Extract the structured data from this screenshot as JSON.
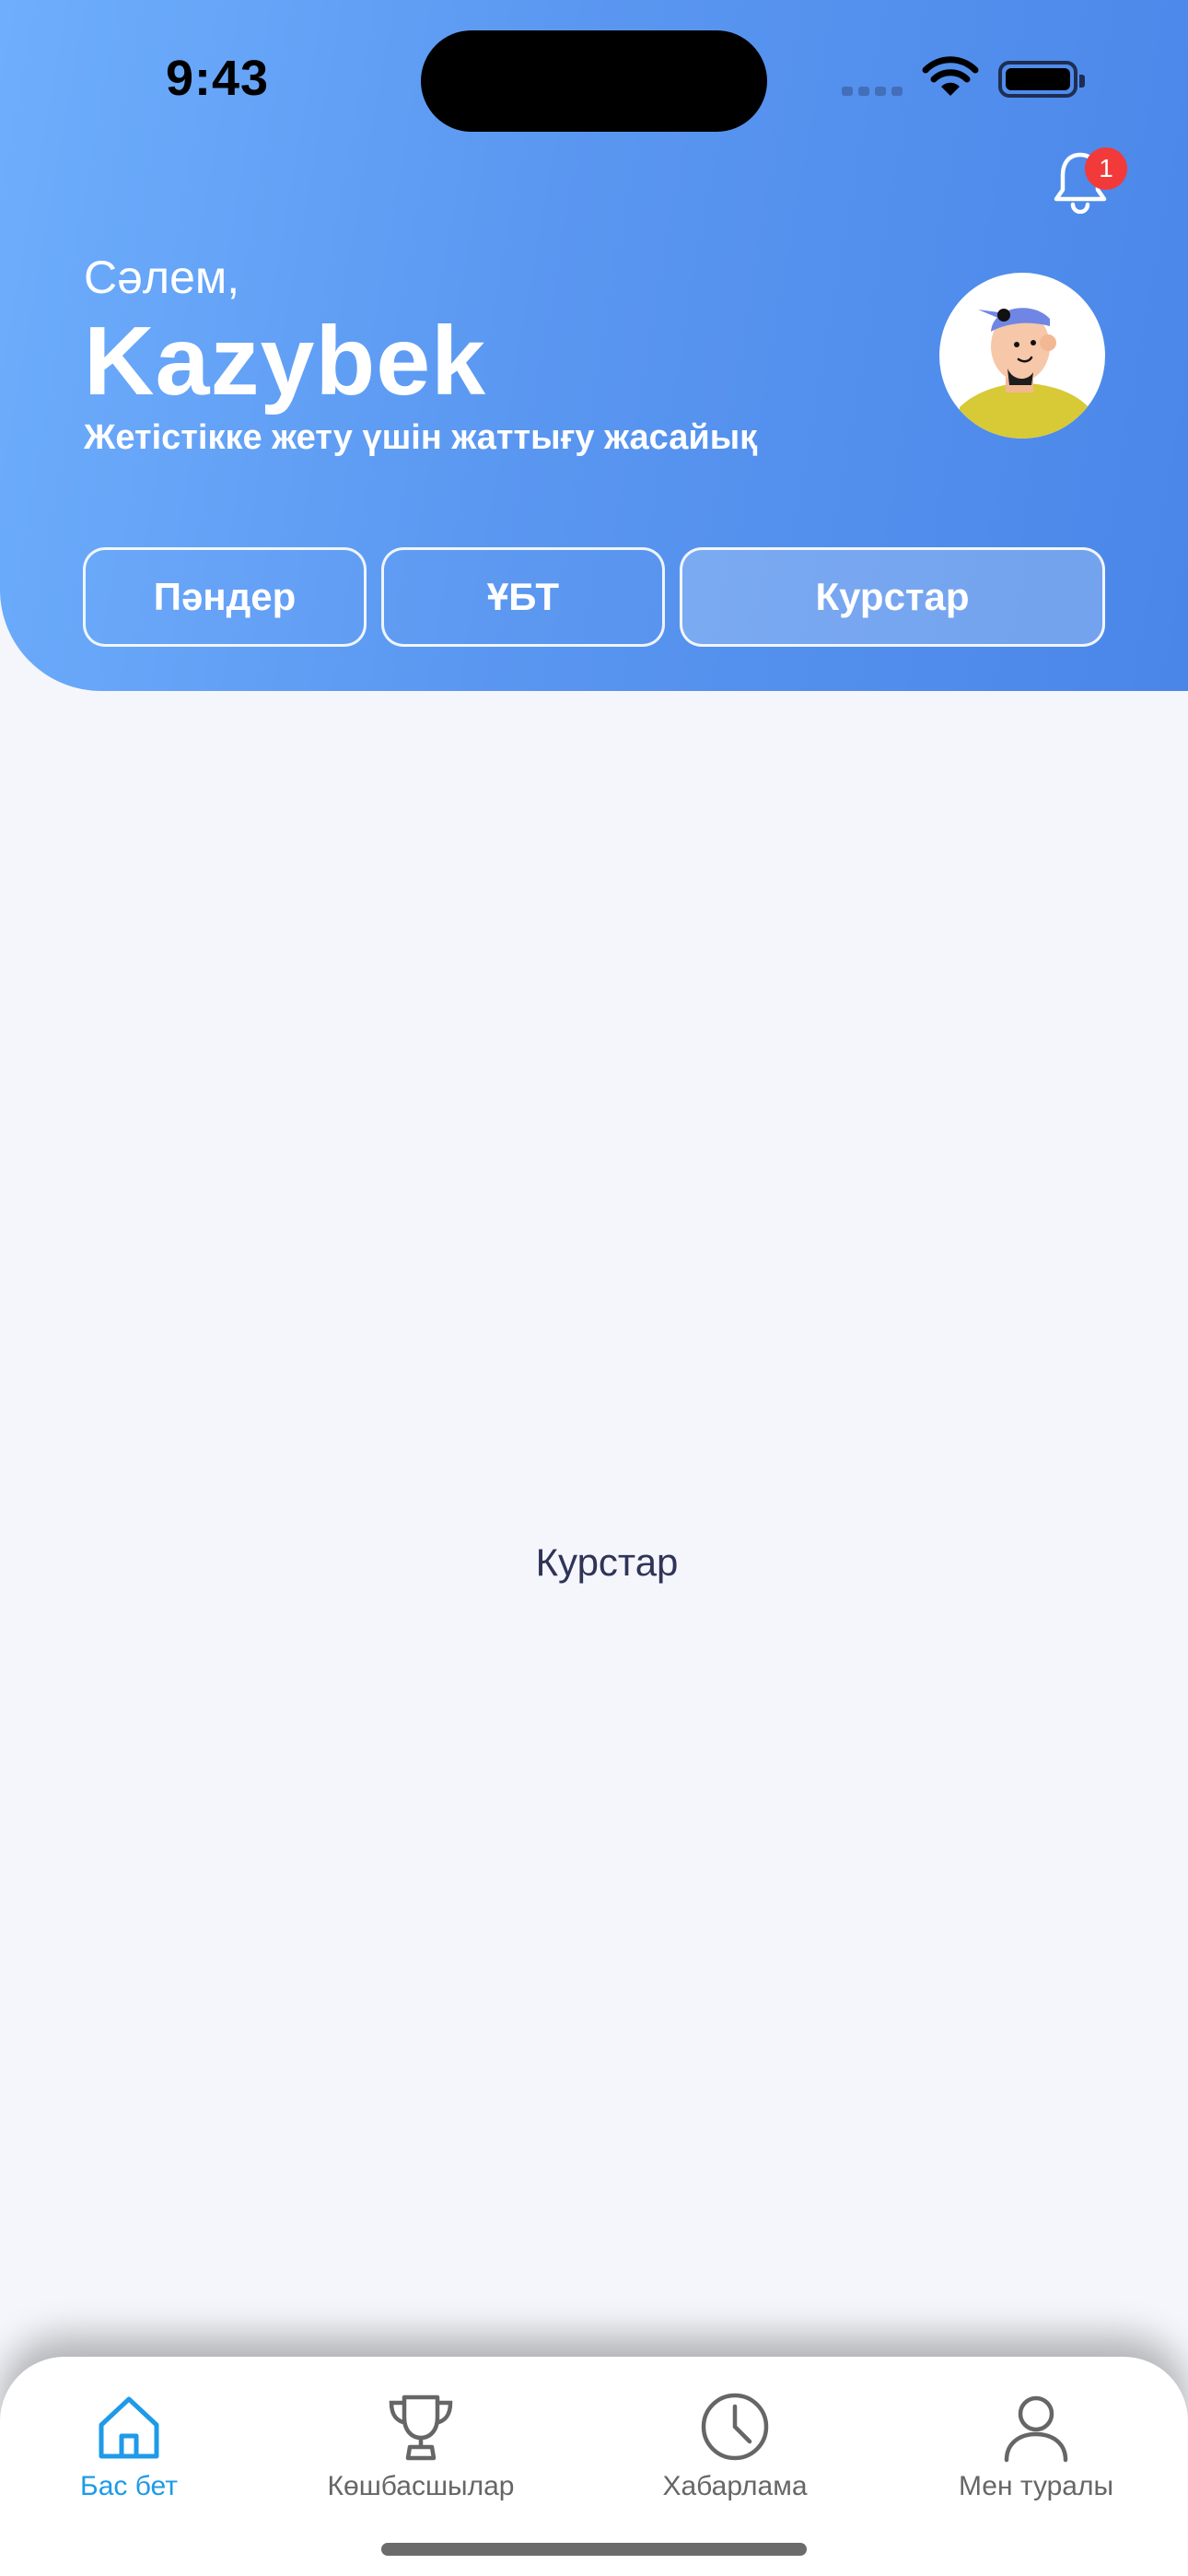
{
  "status_bar": {
    "time": "9:43"
  },
  "notifications": {
    "badge_count": "1"
  },
  "header": {
    "greeting": "Сәлем,",
    "username": "Kazybek",
    "tagline": "Жетістікке жету үшін жаттығу жасайық"
  },
  "tabs": [
    {
      "label": "Пәндер",
      "active": false
    },
    {
      "label": "ҰБТ",
      "active": false
    },
    {
      "label": "Курстар",
      "active": true
    }
  ],
  "content": {
    "placeholder_text": "Курстар"
  },
  "bottom_nav": [
    {
      "label": "Бас бет",
      "icon": "home-icon",
      "active": true
    },
    {
      "label": "Көшбасшылар",
      "icon": "trophy-icon",
      "active": false
    },
    {
      "label": "Хабарлама",
      "icon": "clock-icon",
      "active": false
    },
    {
      "label": "Мен туралы",
      "icon": "user-icon",
      "active": false
    }
  ],
  "colors": {
    "header_gradient_start": "#6eaefc",
    "header_gradient_end": "#4a86e8",
    "active_nav": "#1e9ae8",
    "badge": "#f23a3a",
    "background": "#f4f6fb"
  }
}
